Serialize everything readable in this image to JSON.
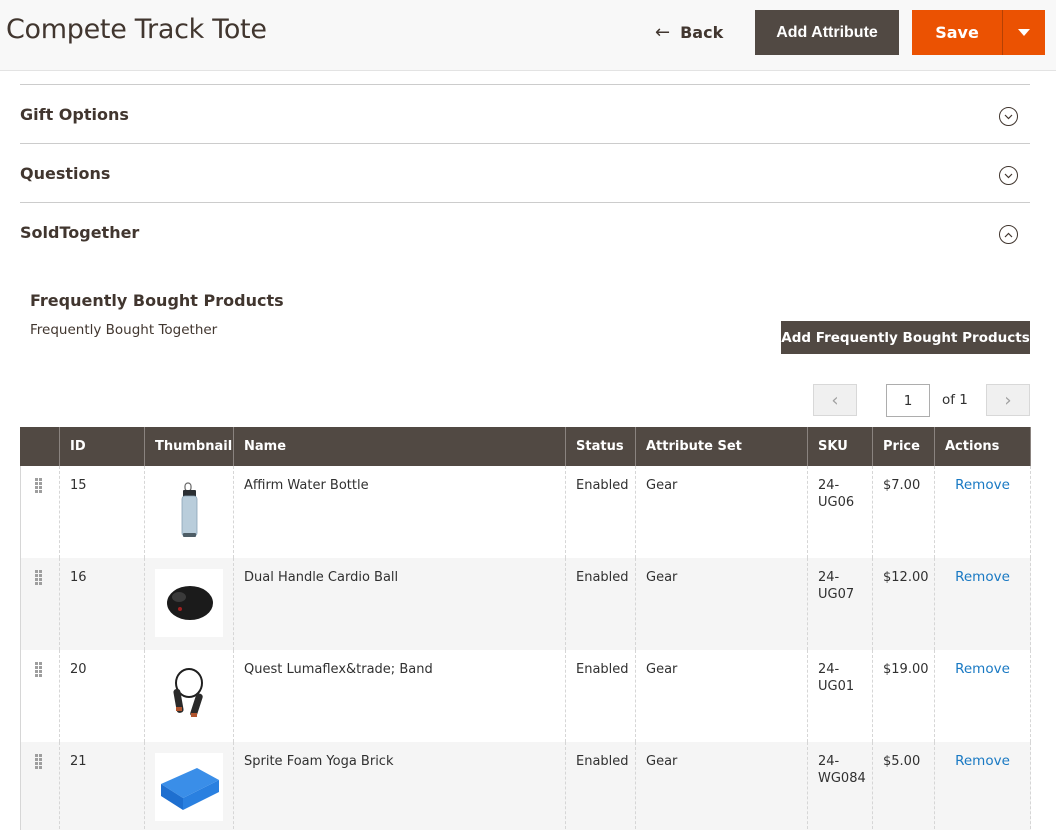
{
  "header": {
    "title": "Compete Track Tote",
    "back_label": "Back",
    "add_attribute_label": "Add Attribute",
    "save_label": "Save"
  },
  "sections": [
    {
      "title": "Gift Options",
      "state": "collapsed"
    },
    {
      "title": "Questions",
      "state": "collapsed"
    },
    {
      "title": "SoldTogether",
      "state": "expanded"
    }
  ],
  "frequently_bought": {
    "title": "Frequently Bought Products",
    "subtitle": "Frequently Bought Together",
    "add_button_label": "Add Frequently Bought Products",
    "pager": {
      "current_page": "1",
      "of_label": "of 1"
    },
    "columns": [
      "",
      "ID",
      "Thumbnail",
      "Name",
      "Status",
      "Attribute Set",
      "SKU",
      "Price",
      "Actions"
    ],
    "rows": [
      {
        "id": "15",
        "thumbnail": "water-bottle",
        "name": "Affirm Water Bottle",
        "status": "Enabled",
        "attribute_set": "Gear",
        "sku_line1": "24-",
        "sku_line2": "UG06",
        "price": "$7.00",
        "action": "Remove"
      },
      {
        "id": "16",
        "thumbnail": "cardio-ball",
        "name": "Dual Handle Cardio Ball",
        "status": "Enabled",
        "attribute_set": "Gear",
        "sku_line1": "24-",
        "sku_line2": "UG07",
        "price": "$12.00",
        "action": "Remove"
      },
      {
        "id": "20",
        "thumbnail": "resistance-band",
        "name": "Quest Lumaflex&trade; Band",
        "status": "Enabled",
        "attribute_set": "Gear",
        "sku_line1": "24-",
        "sku_line2": "UG01",
        "price": "$19.00",
        "action": "Remove"
      },
      {
        "id": "21",
        "thumbnail": "yoga-brick",
        "name": "Sprite Foam Yoga Brick",
        "status": "Enabled",
        "attribute_set": "Gear",
        "sku_line1": "24-",
        "sku_line2": "WG084",
        "price": "$5.00",
        "action": "Remove"
      }
    ]
  },
  "colors": {
    "primary_dark": "#514943",
    "accent_orange": "#eb5202",
    "link_blue": "#1979c3",
    "title_text": "#41362f"
  }
}
